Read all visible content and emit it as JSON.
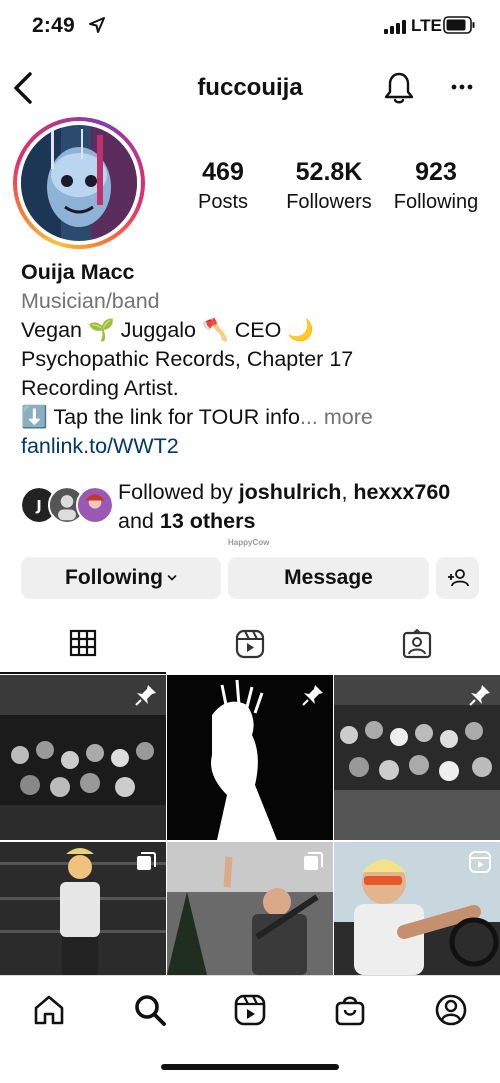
{
  "status_bar": {
    "time": "2:49",
    "network": "LTE"
  },
  "header": {
    "username": "fuccouija"
  },
  "stats": [
    {
      "value": "469",
      "label": "Posts"
    },
    {
      "value": "52.8K",
      "label": "Followers"
    },
    {
      "value": "923",
      "label": "Following"
    }
  ],
  "bio": {
    "name": "Ouija Macc",
    "category": "Musician/band",
    "line1": "Vegan 🌱 Juggalo 🪓 CEO 🌙",
    "line2": "Psychopathic Records, Chapter 17",
    "line3": "Recording Artist.",
    "line4_prefix": "⬇️ Tap the link for TOUR info",
    "line4_more": "... more",
    "link": "fanlink.to/WWT2"
  },
  "followed_by": {
    "prefix": "Followed by ",
    "user1": "joshulrich",
    "comma": ",",
    "user2": "hexxx760",
    "and_text": " and ",
    "others": "13 others"
  },
  "watermark": "HappyCow",
  "actions": {
    "following_label": "Following",
    "message_label": "Message"
  },
  "tabs": [
    "grid-icon",
    "reels-icon",
    "tagged-icon"
  ],
  "posts": [
    {
      "desc": "concert-crowd",
      "badge": "pin-icon"
    },
    {
      "desc": "silhouette",
      "badge": "pin-icon"
    },
    {
      "desc": "crowd",
      "badge": "pin-icon"
    },
    {
      "desc": "vegan-fashion-week",
      "badge": "multi-icon"
    },
    {
      "desc": "woman-with-rifle",
      "badge": "multi-icon"
    },
    {
      "desc": "driving",
      "badge": "reel-icon"
    }
  ],
  "colors": {
    "link": "#00376b",
    "secondary_text": "#737373",
    "button_bg": "#efefef"
  }
}
